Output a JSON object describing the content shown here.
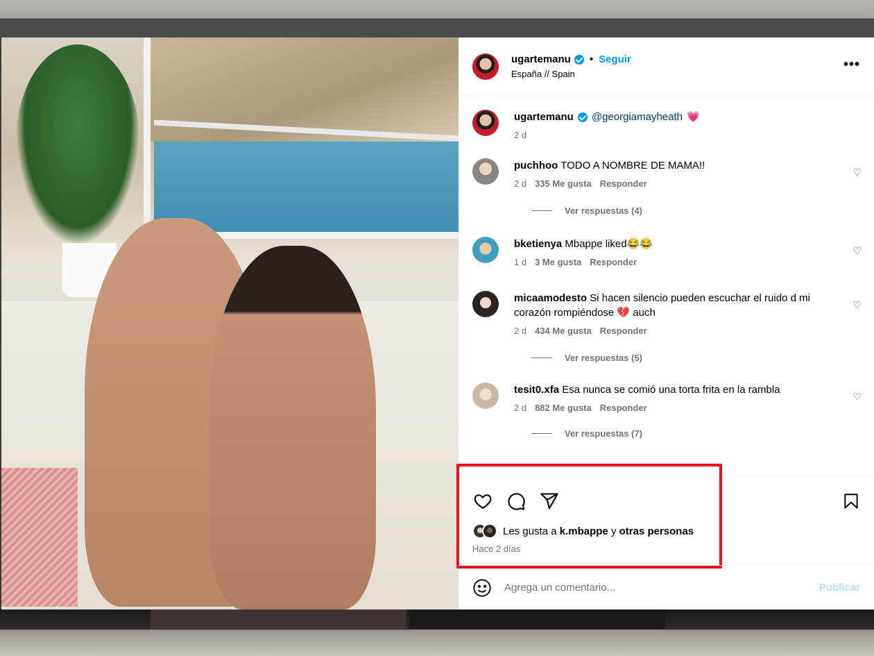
{
  "post": {
    "username": "ugartemanu",
    "follow_label": "Seguir",
    "separator": "•",
    "location": "España // Spain",
    "more_label": "•••"
  },
  "caption": {
    "username": "ugartemanu",
    "mention": "@georgiamayheath",
    "emoji": "💗",
    "time": "2 d"
  },
  "comments": [
    {
      "username": "puchhoo",
      "text": "TODO A NOMBRE DE MAMA!!",
      "time": "2 d",
      "likes": "335 Me gusta",
      "reply": "Responder",
      "replies": "Ver respuestas (4)"
    },
    {
      "username": "bketienya",
      "text": "Mbappe liked😂😂",
      "time": "1 d",
      "likes": "3 Me gusta",
      "reply": "Responder",
      "replies": ""
    },
    {
      "username": "micaamodesto",
      "text": "Si hacen silencio pueden escuchar el ruido d mi corazón rompiéndose 💔 auch",
      "time": "2 d",
      "likes": "434 Me gusta",
      "reply": "Responder",
      "replies": "Ver respuestas (5)"
    },
    {
      "username": "tesit0.xfa",
      "text": "Esa nunca se comió una torta frita en la rambla",
      "time": "2 d",
      "likes": "882 Me gusta",
      "reply": "Responder",
      "replies": "Ver respuestas (7)"
    }
  ],
  "actions": {
    "icons": [
      "heart-icon",
      "comment-icon",
      "share-icon",
      "bookmark-icon"
    ],
    "likes_prefix": "Les gusta a",
    "likes_user": "k.mbappe",
    "likes_conj": "y",
    "likes_others": "otras personas",
    "time_ago": "Hace 2 días"
  },
  "add_comment": {
    "placeholder": "Agrega un comentario...",
    "publish_label": "Publicar"
  },
  "colors": {
    "accent": "#0095f6",
    "highlight_box": "#e8101a",
    "mention": "#00376b"
  }
}
